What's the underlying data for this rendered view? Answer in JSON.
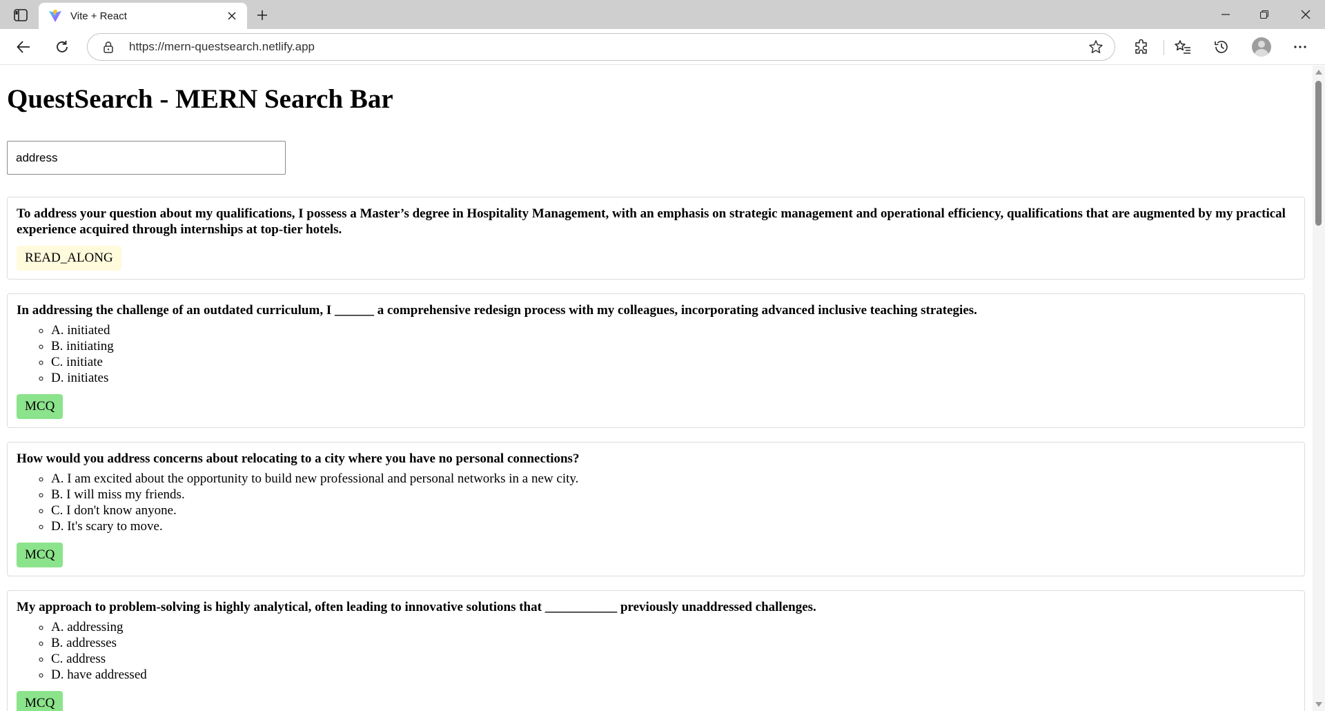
{
  "browser": {
    "tab_title": "Vite + React",
    "url": "https://mern-questsearch.netlify.app",
    "icons": [
      "sidebar-toggle-icon",
      "vite-logo-icon",
      "close-icon",
      "plus-icon",
      "minimize-icon",
      "restore-icon",
      "back-icon",
      "refresh-icon",
      "lock-icon",
      "star-icon",
      "extensions-icon",
      "favorites-icon",
      "history-icon",
      "more-icon"
    ]
  },
  "page": {
    "title": "QuestSearch - MERN Search Bar",
    "search": {
      "value": "address",
      "placeholder": ""
    }
  },
  "results": [
    {
      "question": "To address your question about my qualifications, I possess a Master’s degree in Hospitality Management, with an emphasis on strategic management and operational efficiency, qualifications that are augmented by my practical experience acquired through internships at top-tier hotels.",
      "options": [],
      "type": "READ_ALONG"
    },
    {
      "question": "In addressing the challenge of an outdated curriculum, I ______ a comprehensive redesign process with my colleagues, incorporating advanced inclusive teaching strategies.",
      "options": [
        "A. initiated",
        "B. initiating",
        "C. initiate",
        "D. initiates"
      ],
      "type": "MCQ"
    },
    {
      "question": "How would you address concerns about relocating to a city where you have no personal connections?",
      "options": [
        "A. I am excited about the opportunity to build new professional and personal networks in a new city.",
        "B. I will miss my friends.",
        "C. I don't know anyone.",
        "D. It's scary to move."
      ],
      "type": "MCQ"
    },
    {
      "question": "My approach to problem-solving is highly analytical, often leading to innovative solutions that ___________ previously unaddressed challenges.",
      "options": [
        "A. addressing",
        "B. addresses",
        "C. address",
        "D. have addressed"
      ],
      "type": "MCQ"
    }
  ],
  "colors": {
    "read_along_badge": "#fffbdc",
    "mcq_badge": "#8be38b",
    "tabbar": "#cfcfcf"
  }
}
